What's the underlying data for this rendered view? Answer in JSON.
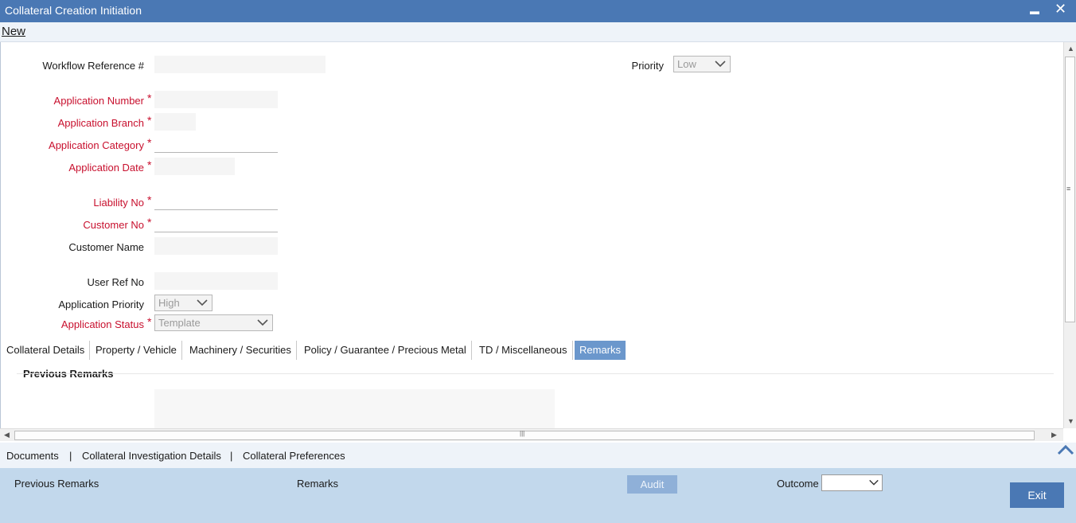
{
  "window": {
    "title": "Collateral Creation Initiation",
    "minimize": "▬",
    "close": "✕"
  },
  "menu": {
    "new_label": "New"
  },
  "form": {
    "workflow_ref_label": "Workflow Reference #",
    "priority_label": "Priority",
    "priority_value": "Low",
    "application_number_label": "Application Number",
    "application_branch_label": "Application Branch",
    "application_category_label": "Application Category",
    "application_date_label": "Application Date",
    "liability_no_label": "Liability No",
    "customer_no_label": "Customer No",
    "customer_name_label": "Customer Name",
    "user_ref_label": "User Ref No",
    "app_priority_label": "Application Priority",
    "app_priority_value": "High",
    "app_status_label": "Application Status",
    "app_status_value": "Template",
    "required_mark": "*"
  },
  "tabs": [
    {
      "label": "Collateral Details"
    },
    {
      "label": "Property / Vehicle"
    },
    {
      "label": "Machinery / Securities"
    },
    {
      "label": "Policy / Guarantee / Precious Metal"
    },
    {
      "label": "TD / Miscellaneous"
    },
    {
      "label": "Remarks",
      "active": true
    }
  ],
  "remarks": {
    "section_title": "Previous Remarks"
  },
  "scroll": {
    "grip": "≡",
    "hgrip": "|||"
  },
  "links": {
    "documents": "Documents",
    "investigation": "Collateral Investigation Details",
    "preferences": "Collateral Preferences",
    "separator": "|"
  },
  "footer": {
    "previous_remarks": "Previous Remarks",
    "remarks": "Remarks",
    "audit": "Audit",
    "outcome_label": "Outcome",
    "exit": "Exit"
  },
  "colors": {
    "titlebar": "#4a78b4",
    "required": "#c8102e",
    "active_tab": "#6b97cc",
    "footer": "#c2d8ec"
  }
}
